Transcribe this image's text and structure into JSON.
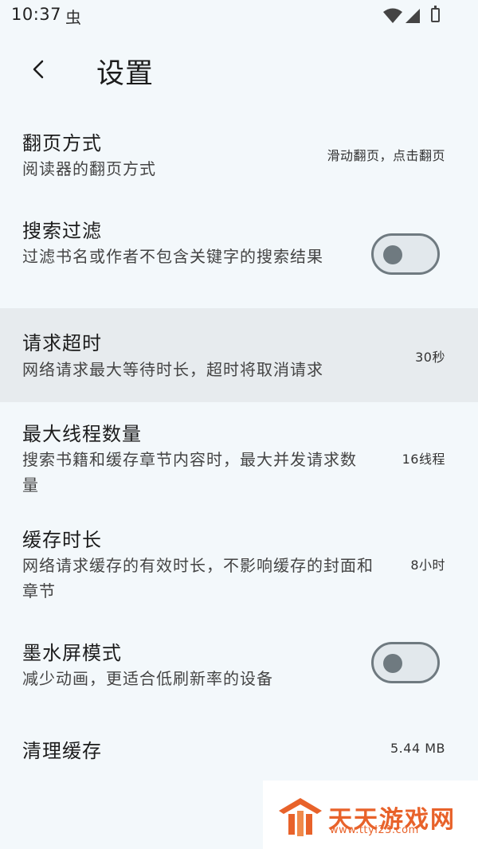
{
  "status_bar": {
    "time": "10:37",
    "notification_glyph": "虫"
  },
  "header": {
    "title": "设置",
    "back_icon": "chevron-left-icon"
  },
  "settings": [
    {
      "title": "翻页方式",
      "desc": "阅读器的翻页方式",
      "value": "滑动翻页，点击翻页"
    },
    {
      "title": "搜索过滤",
      "desc": "过滤书名或作者不包含关键字的搜索结果",
      "toggle": "off"
    },
    {
      "title": "请求超时",
      "desc": "网络请求最大等待时长，超时将取消请求",
      "value": "30秒"
    },
    {
      "title": "最大线程数量",
      "desc": "搜索书籍和缓存章节内容时，最大并发请求数量",
      "value": "16线程"
    },
    {
      "title": "缓存时长",
      "desc": "网络请求缓存的有效时长，不影响缓存的封面和章节",
      "value": "8小时"
    },
    {
      "title": "墨水屏模式",
      "desc": "减少动画，更适合低刷新率的设备",
      "toggle": "off"
    },
    {
      "title": "清理缓存",
      "value": "5.44 MB"
    }
  ],
  "watermark": {
    "title": "天天游戏网",
    "url": "www.ttyl23.com"
  },
  "colors": {
    "background": "#f3f8fb",
    "highlight_row": "#e7ebee",
    "toggle_outline": "#6f7a80",
    "watermark_accent": "#e8622a"
  }
}
